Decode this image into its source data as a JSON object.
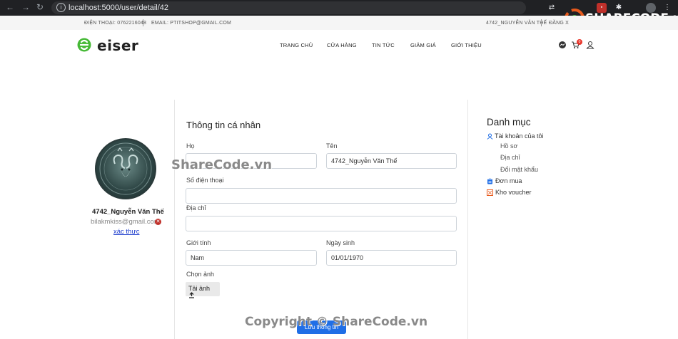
{
  "browser": {
    "url": "localhost:5000/user/detail/42"
  },
  "topbar": {
    "phone": "ĐIỆN THOẠI: 0762216048",
    "email": "EMAIL: PTITSHOP@GMAIL.COM",
    "user": "4742_NGUYỄN VĂN THẾ",
    "logout": "ĐĂNG X"
  },
  "header": {
    "logo_text": "eiser",
    "menu": [
      "TRANG CHỦ",
      "CỬA HÀNG",
      "TIN TỨC",
      "GIẢM GIÁ",
      "GIỚI THIỆU"
    ],
    "cart_count": "0"
  },
  "profile": {
    "username": "4742_Nguyễn Văn Thế",
    "email": "bilakmkiss@gmail.com",
    "verify_link": "xác thực"
  },
  "form": {
    "title": "Thông tin cá nhân",
    "ho_label": "Họ",
    "ho_value": "",
    "ten_label": "Tên",
    "ten_value": "4742_Nguyễn Văn Thế",
    "phone_label": "Số điện thoại",
    "phone_value": "",
    "address_label": "Địa chỉ",
    "address_value": "",
    "gender_label": "Giới tính",
    "gender_value": "Nam",
    "dob_label": "Ngày sinh",
    "dob_value": "01/01/1970",
    "image_label": "Chọn ảnh",
    "upload_button": "Tải ảnh",
    "save_button": "Lưu thông tin"
  },
  "sidebar": {
    "title": "Danh mục",
    "account": "Tài khoản của tôi",
    "sub_items": [
      "Hồ sơ",
      "Địa chỉ",
      "Đổi mật khẩu"
    ],
    "orders": "Đơn mua",
    "voucher": "Kho voucher"
  },
  "watermark": {
    "center": "ShareCode.vn",
    "bottom": "Copyright © ShareCode.vn",
    "logo": "SHARECODE.vn"
  },
  "colors": {
    "accent_blue": "#1f6ee6",
    "logo_green": "#46b936",
    "badge_red": "#e8372c"
  }
}
